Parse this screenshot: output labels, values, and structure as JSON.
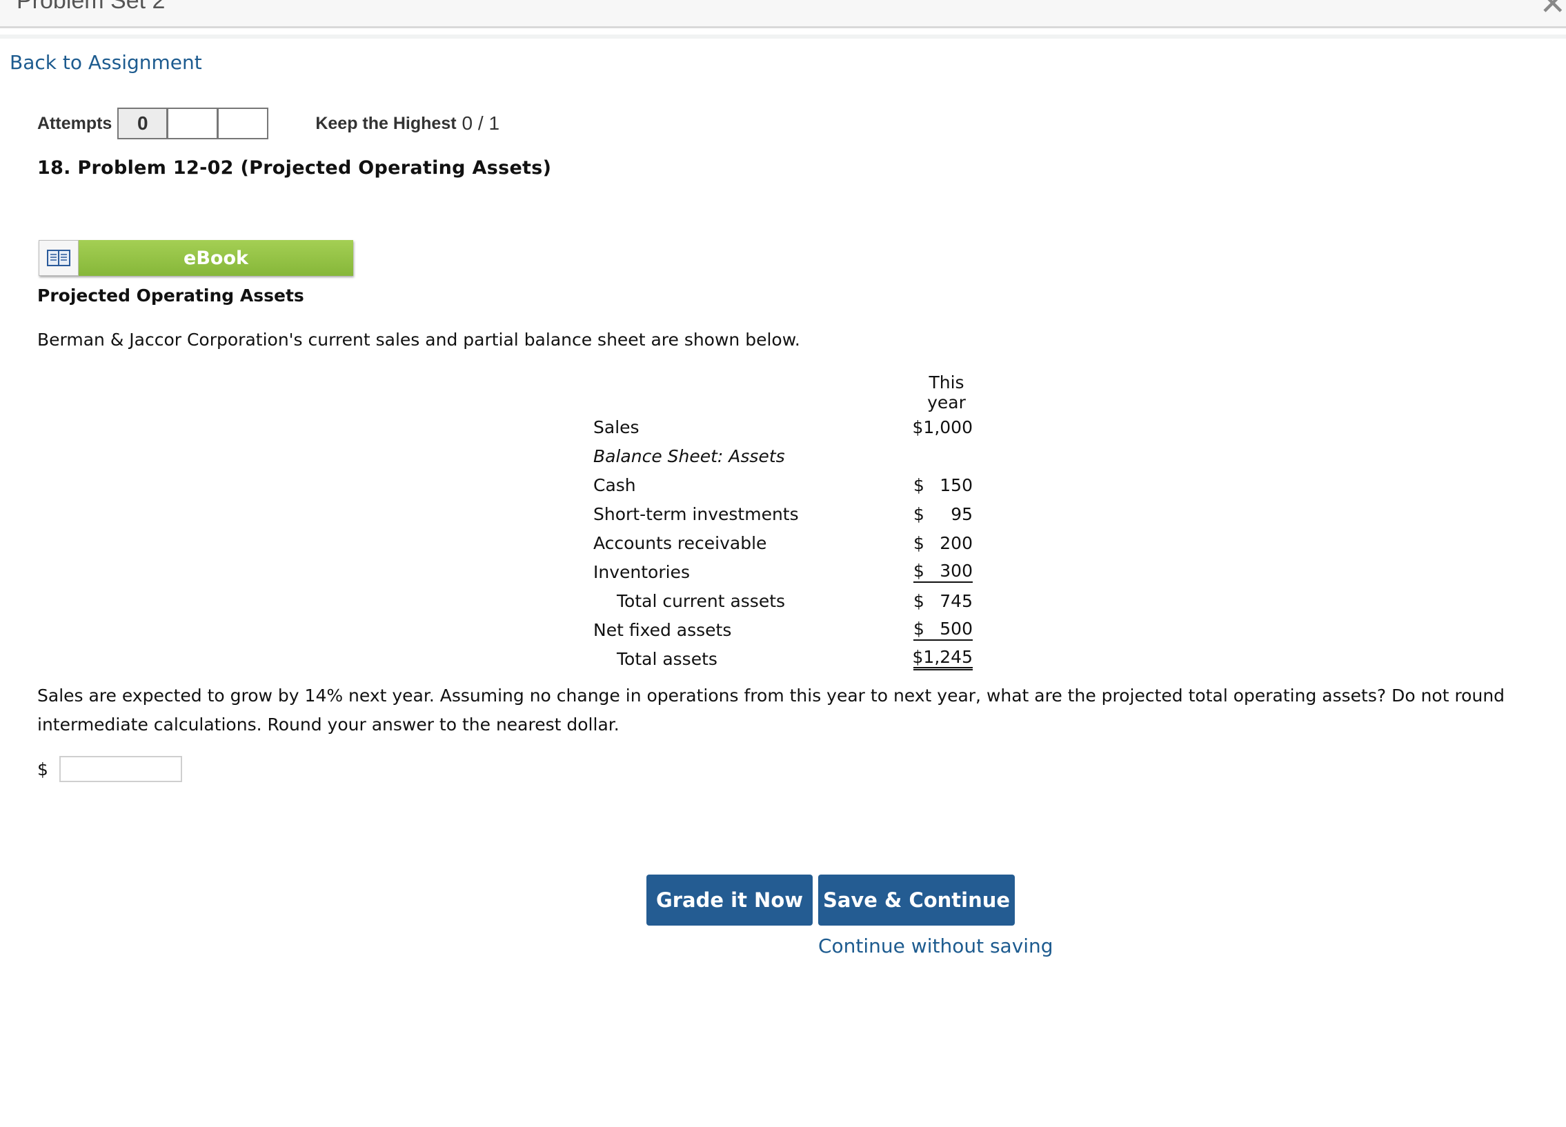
{
  "window": {
    "title": "Problem Set 2"
  },
  "nav": {
    "back_label": "Back to Assignment"
  },
  "attempts": {
    "label": "Attempts",
    "boxes": [
      "0",
      "",
      ""
    ],
    "keep_label": "Keep the Highest",
    "score": "0 / 1"
  },
  "problem": {
    "title": "18.  Problem 12-02 (Projected Operating Assets)",
    "ebook_label": "eBook",
    "section_title": "Projected Operating Assets",
    "intro": "Berman & Jaccor Corporation's current sales and partial balance sheet are shown below."
  },
  "table": {
    "header": "This year",
    "rows": [
      {
        "label": "Sales",
        "sym": "",
        "value": "$1,000"
      },
      {
        "label": "Balance Sheet: Assets",
        "sym": "",
        "value": ""
      },
      {
        "label": "Cash",
        "sym": "$",
        "value": "150"
      },
      {
        "label": "Short-term investments",
        "sym": "$",
        "value": "95"
      },
      {
        "label": "Accounts receivable",
        "sym": "$",
        "value": "200"
      },
      {
        "label": "Inventories",
        "sym": "$",
        "value": "300"
      },
      {
        "label": "Total current assets",
        "sym": "$",
        "value": "745"
      },
      {
        "label": "Net fixed assets",
        "sym": "$",
        "value": "500"
      },
      {
        "label": "Total assets",
        "sym": "",
        "value": "$1,245"
      }
    ]
  },
  "question": {
    "text": "Sales are expected to grow by 14% next year. Assuming no change in operations from this year to next year, what are the projected total operating assets? Do not round intermediate calculations. Round your answer to the nearest dollar.",
    "currency": "$",
    "answer_value": ""
  },
  "actions": {
    "grade_label": "Grade it Now",
    "save_label": "Save & Continue",
    "continue_label": "Continue without saving"
  },
  "colors": {
    "link": "#1d5b8f",
    "button": "#245c92",
    "ebook_green": "#8cbd3d"
  }
}
